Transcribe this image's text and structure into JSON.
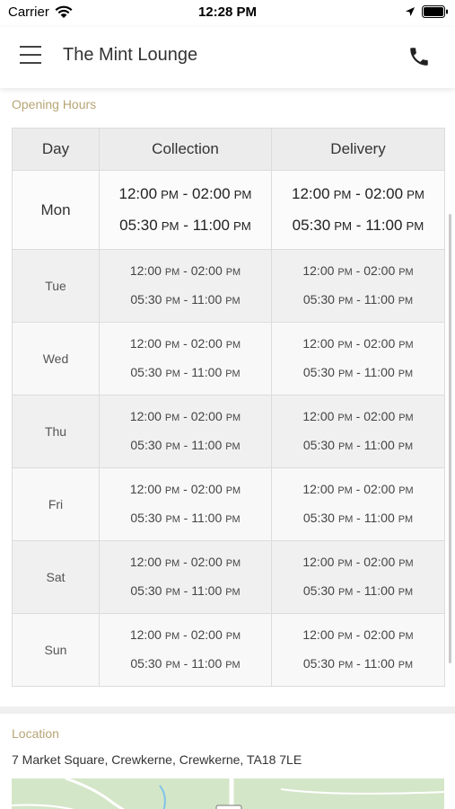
{
  "status_bar": {
    "carrier": "Carrier",
    "time": "12:28 PM",
    "icons": [
      "wifi-icon",
      "location-arrow-icon",
      "battery-icon"
    ]
  },
  "header": {
    "title": "The Mint Lounge",
    "menu_icon": "hamburger-menu-icon",
    "phone_icon": "phone-icon"
  },
  "opening_hours": {
    "heading": "Opening Hours",
    "columns": [
      "Day",
      "Collection",
      "Delivery"
    ],
    "rows": [
      {
        "day": "Mon",
        "collection": [
          [
            "12:00",
            "PM",
            "02:00",
            "PM"
          ],
          [
            "05:30",
            "PM",
            "11:00",
            "PM"
          ]
        ],
        "delivery": [
          [
            "12:00",
            "PM",
            "02:00",
            "PM"
          ],
          [
            "05:30",
            "PM",
            "11:00",
            "PM"
          ]
        ]
      },
      {
        "day": "Tue",
        "collection": [
          [
            "12:00",
            "PM",
            "02:00",
            "PM"
          ],
          [
            "05:30",
            "PM",
            "11:00",
            "PM"
          ]
        ],
        "delivery": [
          [
            "12:00",
            "PM",
            "02:00",
            "PM"
          ],
          [
            "05:30",
            "PM",
            "11:00",
            "PM"
          ]
        ]
      },
      {
        "day": "Wed",
        "collection": [
          [
            "12:00",
            "PM",
            "02:00",
            "PM"
          ],
          [
            "05:30",
            "PM",
            "11:00",
            "PM"
          ]
        ],
        "delivery": [
          [
            "12:00",
            "PM",
            "02:00",
            "PM"
          ],
          [
            "05:30",
            "PM",
            "11:00",
            "PM"
          ]
        ]
      },
      {
        "day": "Thu",
        "collection": [
          [
            "12:00",
            "PM",
            "02:00",
            "PM"
          ],
          [
            "05:30",
            "PM",
            "11:00",
            "PM"
          ]
        ],
        "delivery": [
          [
            "12:00",
            "PM",
            "02:00",
            "PM"
          ],
          [
            "05:30",
            "PM",
            "11:00",
            "PM"
          ]
        ]
      },
      {
        "day": "Fri",
        "collection": [
          [
            "12:00",
            "PM",
            "02:00",
            "PM"
          ],
          [
            "05:30",
            "PM",
            "11:00",
            "PM"
          ]
        ],
        "delivery": [
          [
            "12:00",
            "PM",
            "02:00",
            "PM"
          ],
          [
            "05:30",
            "PM",
            "11:00",
            "PM"
          ]
        ]
      },
      {
        "day": "Sat",
        "collection": [
          [
            "12:00",
            "PM",
            "02:00",
            "PM"
          ],
          [
            "05:30",
            "PM",
            "11:00",
            "PM"
          ]
        ],
        "delivery": [
          [
            "12:00",
            "PM",
            "02:00",
            "PM"
          ],
          [
            "05:30",
            "PM",
            "11:00",
            "PM"
          ]
        ]
      },
      {
        "day": "Sun",
        "collection": [
          [
            "12:00",
            "PM",
            "02:00",
            "PM"
          ],
          [
            "05:30",
            "PM",
            "11:00",
            "PM"
          ]
        ],
        "delivery": [
          [
            "12:00",
            "PM",
            "02:00",
            "PM"
          ],
          [
            "05:30",
            "PM",
            "11:00",
            "PM"
          ]
        ]
      }
    ]
  },
  "location": {
    "heading": "Location",
    "address": "7 Market Square, Crewkerne, Crewkerne, TA18 7LE"
  },
  "colors": {
    "heading_accent": "#b8a576",
    "map_green": "#cfe3c3"
  }
}
